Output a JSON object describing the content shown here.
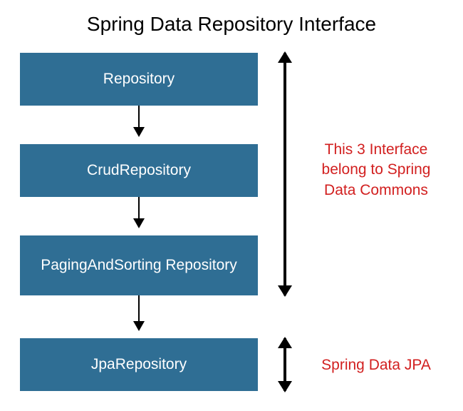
{
  "title": "Spring Data Repository Interface",
  "boxes": {
    "b1": "Repository",
    "b2": "CrudRepository",
    "b3": "PagingAndSorting Repository",
    "b4": "JpaRepository"
  },
  "notes": {
    "n1": "This 3 Interface belong to Spring Data Commons",
    "n2": "Spring Data JPA"
  }
}
